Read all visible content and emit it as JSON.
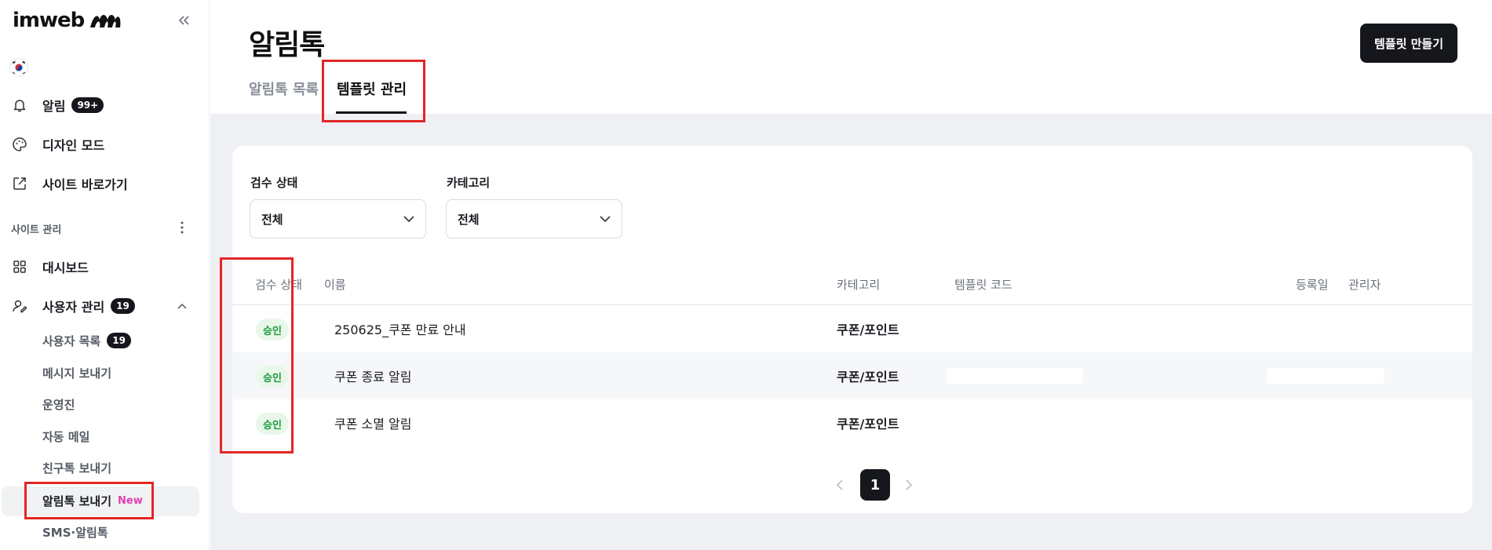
{
  "sidebar": {
    "logo_text": "imweb",
    "nav": [
      {
        "label": "알림",
        "badge": "99+"
      },
      {
        "label": "디자인 모드"
      },
      {
        "label": "사이트 바로가기"
      }
    ],
    "section_label": "사이트 관리",
    "nav2": [
      {
        "label": "대시보드"
      },
      {
        "label": "사용자 관리",
        "badge": "19"
      }
    ],
    "sub_items": [
      {
        "label": "사용자 목록",
        "badge": "19"
      },
      {
        "label": "메시지 보내기"
      },
      {
        "label": "운영진"
      },
      {
        "label": "자동 메일"
      },
      {
        "label": "친구톡 보내기"
      },
      {
        "label": "알림톡 보내기",
        "tag": "New"
      },
      {
        "label": "SMS·알림톡"
      }
    ]
  },
  "header": {
    "title": "알림톡",
    "create_button": "템플릿 만들기",
    "tabs": [
      {
        "label": "알림톡 목록"
      },
      {
        "label": "템플릿 관리"
      }
    ]
  },
  "filters": {
    "status_label": "검수 상태",
    "status_value": "전체",
    "category_label": "카테고리",
    "category_value": "전체"
  },
  "table": {
    "headers": [
      "검수 상태",
      "이름",
      "카테고리",
      "템플릿 코드",
      "등록일",
      "관리자"
    ],
    "rows": [
      {
        "status": "승인",
        "name": "250625_쿠폰 만료 안내",
        "category": "쿠폰/포인트"
      },
      {
        "status": "승인",
        "name": "쿠폰 종료 알림",
        "category": "쿠폰/포인트"
      },
      {
        "status": "승인",
        "name": "쿠폰 소멸 알림",
        "category": "쿠폰/포인트"
      }
    ]
  },
  "pagination": {
    "current": "1"
  },
  "colors": {
    "accent_dark": "#15171c",
    "approved_green": "#1c9b3a",
    "highlight_red": "#e32626",
    "new_pink": "#e040b0"
  }
}
